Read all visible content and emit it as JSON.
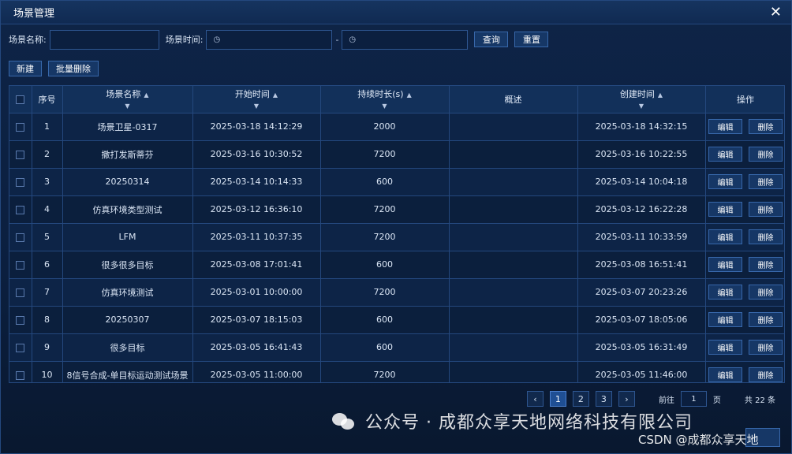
{
  "dialog": {
    "title": "场景管理"
  },
  "filters": {
    "name_label": "场景名称:",
    "name_value": "",
    "time_label": "场景时间:",
    "date_separator": "-",
    "query_label": "查询",
    "reset_label": "重置"
  },
  "toolbar": {
    "new_label": "新建",
    "batch_delete_label": "批量删除"
  },
  "table": {
    "headers": {
      "index": "序号",
      "name": "场景名称",
      "start": "开始时间",
      "duration": "持续时长(s)",
      "summary": "概述",
      "created": "创建时间",
      "ops": "操作"
    },
    "edit_label": "编辑",
    "delete_label": "删除",
    "rows": [
      {
        "index": "1",
        "name": "场景卫星-0317",
        "start": "2025-03-18 14:12:29",
        "duration": "2000",
        "summary": "",
        "created": "2025-03-18 14:32:15"
      },
      {
        "index": "2",
        "name": "撒打发斯蒂芬",
        "start": "2025-03-16 10:30:52",
        "duration": "7200",
        "summary": "",
        "created": "2025-03-16 10:22:55"
      },
      {
        "index": "3",
        "name": "20250314",
        "start": "2025-03-14 10:14:33",
        "duration": "600",
        "summary": "",
        "created": "2025-03-14 10:04:18"
      },
      {
        "index": "4",
        "name": "仿真环境类型测试",
        "start": "2025-03-12 16:36:10",
        "duration": "7200",
        "summary": "",
        "created": "2025-03-12 16:22:28"
      },
      {
        "index": "5",
        "name": "LFM",
        "start": "2025-03-11 10:37:35",
        "duration": "7200",
        "summary": "",
        "created": "2025-03-11 10:33:59"
      },
      {
        "index": "6",
        "name": "很多很多目标",
        "start": "2025-03-08 17:01:41",
        "duration": "600",
        "summary": "",
        "created": "2025-03-08 16:51:41"
      },
      {
        "index": "7",
        "name": "仿真环境测试",
        "start": "2025-03-01 10:00:00",
        "duration": "7200",
        "summary": "",
        "created": "2025-03-07 20:23:26"
      },
      {
        "index": "8",
        "name": "20250307",
        "start": "2025-03-07 18:15:03",
        "duration": "600",
        "summary": "",
        "created": "2025-03-07 18:05:06"
      },
      {
        "index": "9",
        "name": "很多目标",
        "start": "2025-03-05 16:41:43",
        "duration": "600",
        "summary": "",
        "created": "2025-03-05 16:31:49"
      },
      {
        "index": "10",
        "name": "8信号合成-单目标运动测试场景",
        "start": "2025-03-05 11:00:00",
        "duration": "7200",
        "summary": "",
        "created": "2025-03-05 11:46:00"
      }
    ]
  },
  "pagination": {
    "pages": [
      "1",
      "2",
      "3"
    ],
    "current": "1",
    "goto_label": "前往",
    "goto_value": "1",
    "page_unit": "页",
    "total_label": "共 22 条"
  },
  "watermark": {
    "text": "公众号 · 成都众享天地网络科技有限公司",
    "csdn": "CSDN @成都众享天地"
  }
}
